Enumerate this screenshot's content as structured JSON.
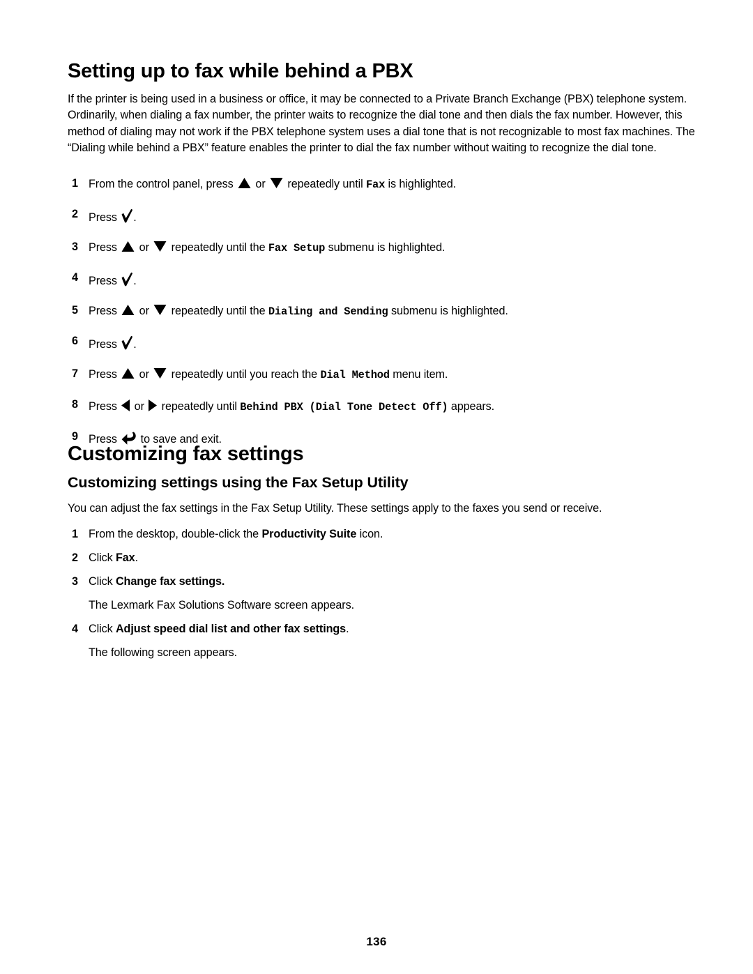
{
  "page": {
    "number": "136"
  },
  "section1": {
    "heading": "Setting up to fax while behind a PBX",
    "paragraph": "If the printer is being used in a business or office, it may be connected to a Private Branch Exchange (PBX) telephone system. Ordinarily, when dialing a fax number, the printer waits to recognize the dial tone and then dials the fax number. However, this method of dialing may not work if the PBX telephone system uses a dial tone that is not recognizable to most fax machines. The “Dialing while behind a PBX” feature enables the printer to dial the fax number without waiting to recognize the dial tone.",
    "steps": [
      {
        "num": "1",
        "pre": "From the control panel, press ",
        "icons": [
          "up-arrow-icon",
          "down-arrow-icon"
        ],
        "mid": " or ",
        "post": " repeatedly until ",
        "mono": "Fax",
        "tail": " is highlighted."
      },
      {
        "num": "2",
        "pre": "Press ",
        "icons": [
          "check-icon"
        ],
        "tail": "."
      },
      {
        "num": "3",
        "pre": "Press ",
        "icons": [
          "up-arrow-icon",
          "down-arrow-icon"
        ],
        "mid": " or ",
        "post": " repeatedly until the ",
        "mono": "Fax Setup",
        "tail": " submenu is highlighted."
      },
      {
        "num": "4",
        "pre": "Press ",
        "icons": [
          "check-icon"
        ],
        "tail": "."
      },
      {
        "num": "5",
        "pre": "Press ",
        "icons": [
          "up-arrow-icon",
          "down-arrow-icon"
        ],
        "mid": " or ",
        "post": " repeatedly until the ",
        "mono": "Dialing and Sending",
        "tail": " submenu is highlighted."
      },
      {
        "num": "6",
        "pre": "Press ",
        "icons": [
          "check-icon"
        ],
        "tail": "."
      },
      {
        "num": "7",
        "pre": "Press ",
        "icons": [
          "up-arrow-icon",
          "down-arrow-icon"
        ],
        "mid": " or ",
        "post": " repeatedly until you reach the ",
        "mono": "Dial Method",
        "tail": " menu item."
      },
      {
        "num": "8",
        "pre": "Press ",
        "icons": [
          "left-arrow-icon",
          "right-arrow-icon"
        ],
        "mid": " or ",
        "post": " repeatedly until ",
        "mono": "Behind PBX (Dial Tone Detect Off)",
        "tail": " appears."
      },
      {
        "num": "9",
        "pre": "Press ",
        "icons": [
          "back-arrow-icon"
        ],
        "tail": " to save and exit."
      }
    ]
  },
  "section2": {
    "heading": "Customizing fax settings",
    "subheading": "Customizing settings using the Fax Setup Utility",
    "paragraph": "You can adjust the fax settings in the Fax Setup Utility. These settings apply to the faxes you send or receive.",
    "steps": [
      {
        "num": "1",
        "pre": "From the desktop, double-click the ",
        "bold": "Productivity Suite",
        "tail": " icon."
      },
      {
        "num": "2",
        "pre": "Click ",
        "bold": "Fax",
        "tail": "."
      },
      {
        "num": "3",
        "pre": "Click ",
        "bold": "Change fax settings.",
        "tail": "",
        "sub": "The Lexmark Fax Solutions Software screen appears."
      },
      {
        "num": "4",
        "pre": "Click ",
        "bold": "Adjust speed dial list and other fax settings",
        "tail": ".",
        "sub": "The following screen appears."
      }
    ]
  }
}
